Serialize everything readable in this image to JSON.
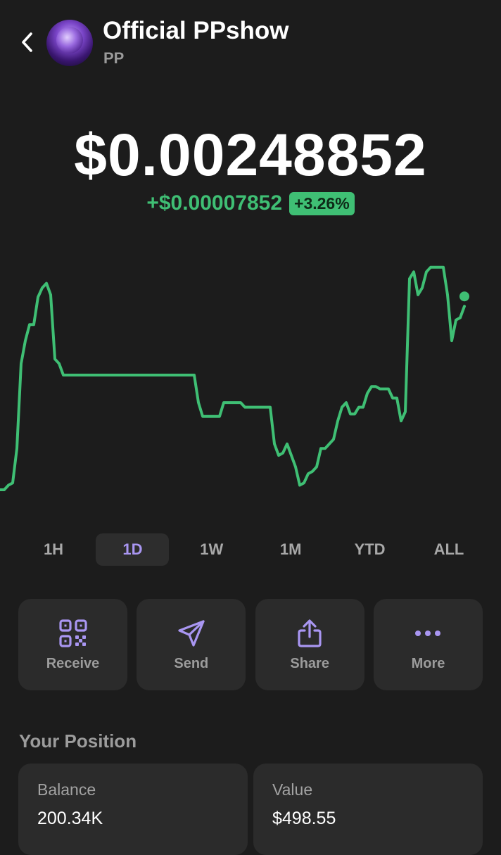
{
  "header": {
    "back_icon": "chevron-left-icon",
    "avatar_icon": "token-avatar",
    "name": "Official PPshow",
    "symbol": "PP"
  },
  "price": {
    "value": "$0.00248852",
    "change_amount": "+$0.00007852",
    "change_percent": "+3.26%"
  },
  "colors": {
    "positive": "#3fbf74",
    "accent": "#a996f2",
    "background": "#1c1c1c",
    "card": "#2b2b2b"
  },
  "chart_data": {
    "type": "line",
    "series": [
      {
        "values": [
          0.0,
          0.0,
          0.02,
          0.03,
          0.18,
          0.55,
          0.65,
          0.72,
          0.72,
          0.84,
          0.88,
          0.9,
          0.85,
          0.57,
          0.55,
          0.5,
          0.5,
          0.5,
          0.5,
          0.5,
          0.5,
          0.5,
          0.5,
          0.5,
          0.5,
          0.5,
          0.5,
          0.5,
          0.5,
          0.5,
          0.5,
          0.5,
          0.5,
          0.5,
          0.5,
          0.5,
          0.5,
          0.5,
          0.5,
          0.5,
          0.5,
          0.5,
          0.5,
          0.5,
          0.5,
          0.5,
          0.5,
          0.38,
          0.32,
          0.32,
          0.32,
          0.32,
          0.32,
          0.38,
          0.38,
          0.38,
          0.38,
          0.38,
          0.36,
          0.36,
          0.36,
          0.36,
          0.36,
          0.36,
          0.36,
          0.2,
          0.15,
          0.16,
          0.2,
          0.15,
          0.1,
          0.02,
          0.03,
          0.07,
          0.08,
          0.1,
          0.18,
          0.18,
          0.2,
          0.22,
          0.3,
          0.36,
          0.38,
          0.33,
          0.33,
          0.36,
          0.36,
          0.42,
          0.45,
          0.45,
          0.44,
          0.44,
          0.44,
          0.4,
          0.4,
          0.3,
          0.34,
          0.92,
          0.95,
          0.85,
          0.88,
          0.95,
          0.97,
          0.97,
          0.97,
          0.97,
          0.85,
          0.65,
          0.74,
          0.75,
          0.8
        ]
      }
    ],
    "current_point": "last"
  },
  "ranges": {
    "items": [
      {
        "label": "1H",
        "active": false
      },
      {
        "label": "1D",
        "active": true
      },
      {
        "label": "1W",
        "active": false
      },
      {
        "label": "1M",
        "active": false
      },
      {
        "label": "YTD",
        "active": false
      },
      {
        "label": "ALL",
        "active": false
      }
    ]
  },
  "actions": {
    "receive": {
      "label": "Receive",
      "icon": "qr-code-icon"
    },
    "send": {
      "label": "Send",
      "icon": "paper-plane-icon"
    },
    "share": {
      "label": "Share",
      "icon": "share-icon"
    },
    "more": {
      "label": "More",
      "icon": "more-dots-icon"
    }
  },
  "position": {
    "title": "Your Position",
    "balance_label": "Balance",
    "balance_value": "200.34K",
    "value_label": "Value",
    "value_value": "$498.55"
  }
}
